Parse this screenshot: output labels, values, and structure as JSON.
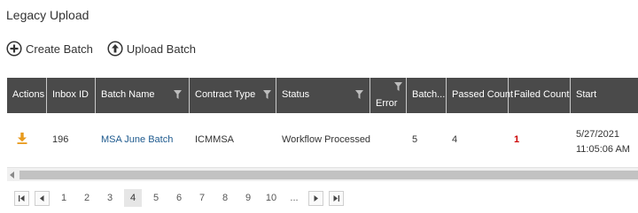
{
  "page": {
    "title": "Legacy Upload"
  },
  "toolbar": {
    "create_label": "Create Batch",
    "upload_label": "Upload Batch"
  },
  "grid": {
    "columns": [
      "Actions",
      "Inbox ID",
      "Batch Name",
      "Contract Type",
      "Status",
      "Error",
      "Batch...",
      "Passed Count",
      "Failed Count",
      "Start"
    ],
    "rows": [
      {
        "action_icon": "download-icon",
        "inbox_id": "196",
        "batch_name": "MSA June Batch",
        "contract_type": "ICMMSA",
        "status": "Workflow Processed",
        "error": "",
        "batch": "5",
        "passed_count": "4",
        "failed_count": "1",
        "start_date": "5/27/2021",
        "start_time": "11:05:06 AM"
      }
    ]
  },
  "pager": {
    "pages": [
      "1",
      "2",
      "3",
      "4",
      "5",
      "6",
      "7",
      "8",
      "9",
      "10"
    ],
    "current_page": "4",
    "ellipsis": "..."
  },
  "colors": {
    "header_bg": "#4a4a4a",
    "link": "#1e5a8e",
    "error": "#cc0000",
    "action": "#e89a1c"
  }
}
